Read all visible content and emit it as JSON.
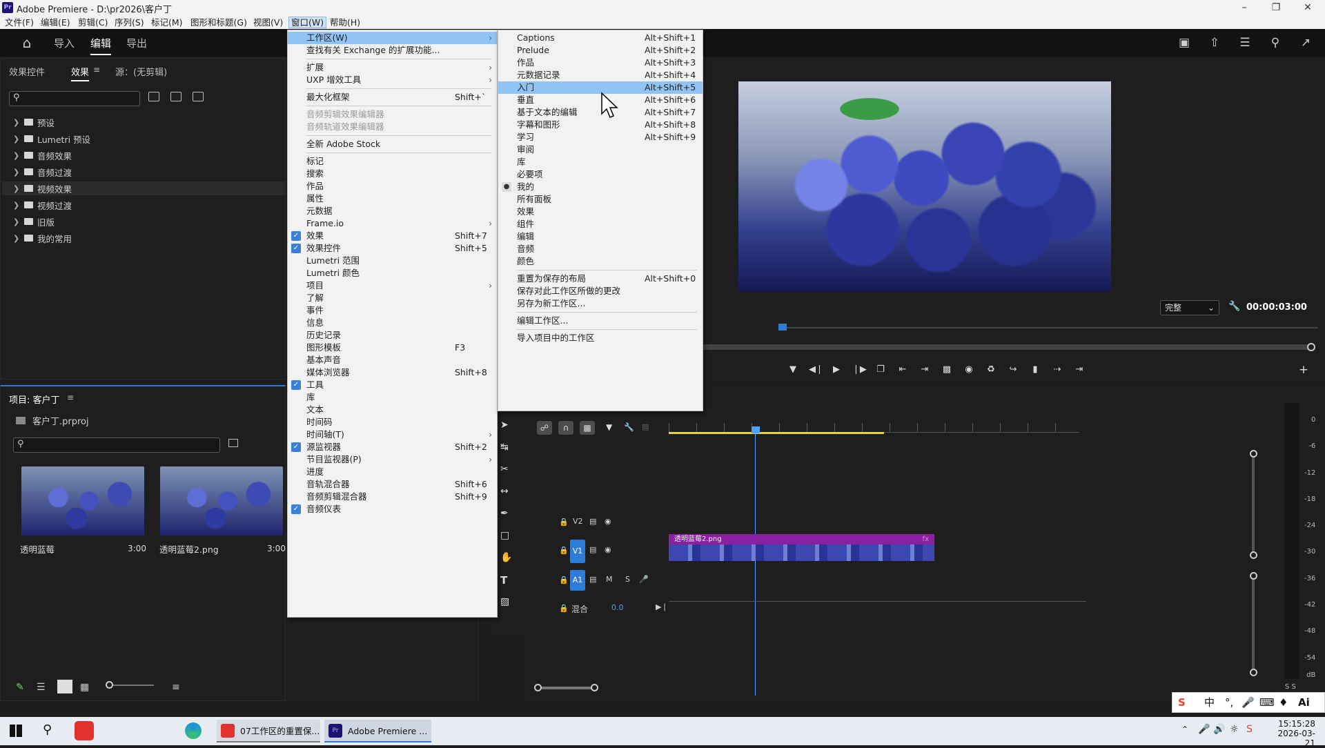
{
  "window": {
    "title": "Adobe Premiere - D:\\pr2026\\客户丁",
    "icon": "Pr"
  },
  "menubar": [
    "文件(F)",
    "编辑(E)",
    "剪辑(C)",
    "序列(S)",
    "标记(M)",
    "图形和标题(G)",
    "视图(V)",
    "窗口(W)",
    "帮助(H)"
  ],
  "header": {
    "tabs": [
      "导入",
      "编辑",
      "导出"
    ]
  },
  "effects_panel": {
    "tabs": [
      "效果控件",
      "效果",
      "源：(无剪辑)"
    ],
    "tree": [
      "预设",
      "Lumetri 预设",
      "音频效果",
      "音频过渡",
      "视频效果",
      "视频过渡",
      "旧版",
      "我的常用"
    ]
  },
  "project_panel": {
    "title": "项目: 客户丁",
    "file": "客户丁.prproj",
    "items": [
      {
        "name": "透明蓝莓",
        "duration": "3:00"
      },
      {
        "name": "透明蓝莓2.png",
        "duration": "3:00"
      }
    ]
  },
  "window_menu": {
    "items": [
      {
        "label": "工作区(W)",
        "submenu": true,
        "highlight": true
      },
      {
        "label": "查找有关 Exchange 的扩展功能..."
      },
      {
        "sep": true
      },
      {
        "label": "扩展",
        "submenu": true
      },
      {
        "label": "UXP 增效工具",
        "submenu": true
      },
      {
        "sep": true
      },
      {
        "label": "最大化框架",
        "shortcut": "Shift+`"
      },
      {
        "sep": true
      },
      {
        "label": "音频剪辑效果编辑器",
        "disabled": true
      },
      {
        "label": "音频轨道效果编辑器",
        "disabled": true
      },
      {
        "sep": true
      },
      {
        "label": "全新 Adobe Stock"
      },
      {
        "sep": true
      },
      {
        "label": "标记"
      },
      {
        "label": "搜索"
      },
      {
        "label": "作品"
      },
      {
        "label": "属性"
      },
      {
        "label": "元数据"
      },
      {
        "label": "Frame.io",
        "submenu": true
      },
      {
        "label": "效果",
        "shortcut": "Shift+7",
        "checked": true
      },
      {
        "label": "效果控件",
        "shortcut": "Shift+5",
        "checked": true
      },
      {
        "label": "Lumetri 范围"
      },
      {
        "label": "Lumetri 颜色"
      },
      {
        "label": "项目",
        "submenu": true
      },
      {
        "label": "了解"
      },
      {
        "label": "事件"
      },
      {
        "label": "信息"
      },
      {
        "label": "历史记录"
      },
      {
        "label": "图形模板",
        "shortcut": "F3"
      },
      {
        "label": "基本声音"
      },
      {
        "label": "媒体浏览器",
        "shortcut": "Shift+8"
      },
      {
        "label": "工具",
        "checked": true
      },
      {
        "label": "库"
      },
      {
        "label": "文本"
      },
      {
        "label": "时间码"
      },
      {
        "label": "时间轴(T)",
        "submenu": true
      },
      {
        "label": "源监视器",
        "shortcut": "Shift+2",
        "checked": true
      },
      {
        "label": "节目监视器(P)",
        "submenu": true
      },
      {
        "label": "进度"
      },
      {
        "label": "音轨混合器",
        "shortcut": "Shift+6"
      },
      {
        "label": "音频剪辑混合器",
        "shortcut": "Shift+9"
      },
      {
        "label": "音频仪表",
        "checked": true
      }
    ]
  },
  "workspace_submenu": {
    "items": [
      {
        "label": "Captions",
        "shortcut": "Alt+Shift+1"
      },
      {
        "label": "Prelude",
        "shortcut": "Alt+Shift+2"
      },
      {
        "label": "作品",
        "shortcut": "Alt+Shift+3"
      },
      {
        "label": "元数据记录",
        "shortcut": "Alt+Shift+4"
      },
      {
        "label": "入门",
        "shortcut": "Alt+Shift+5",
        "highlight": true
      },
      {
        "label": "垂直",
        "shortcut": "Alt+Shift+6"
      },
      {
        "label": "基于文本的编辑",
        "shortcut": "Alt+Shift+7"
      },
      {
        "label": "字幕和图形",
        "shortcut": "Alt+Shift+8"
      },
      {
        "label": "学习",
        "shortcut": "Alt+Shift+9"
      },
      {
        "label": "审阅"
      },
      {
        "label": "库"
      },
      {
        "label": "必要项"
      },
      {
        "label": "我的",
        "bullet": true
      },
      {
        "label": "所有面板"
      },
      {
        "label": "效果"
      },
      {
        "label": "组件"
      },
      {
        "label": "编辑"
      },
      {
        "label": "音频"
      },
      {
        "label": "颜色"
      },
      {
        "sep": true
      },
      {
        "label": "重置为保存的布局",
        "shortcut": "Alt+Shift+0"
      },
      {
        "label": "保存对此工作区所做的更改"
      },
      {
        "label": "另存为新工作区..."
      },
      {
        "sep": true
      },
      {
        "label": "编辑工作区..."
      },
      {
        "sep": true
      },
      {
        "label": "导入项目中的工作区"
      }
    ]
  },
  "program_monitor": {
    "fit": "完整",
    "timecode": "00:00:03:00"
  },
  "timeline": {
    "tracks": [
      "V2",
      "V1",
      "A1"
    ],
    "mix_label": "混合",
    "mix_value": "0.0",
    "clip_name": "透明蓝莓2.png",
    "track_letters": [
      "M",
      "S"
    ],
    "fx": "fx"
  },
  "audio_meter": {
    "ticks": [
      "0",
      "-6",
      "-12",
      "-18",
      "-24",
      "-30",
      "-36",
      "-42",
      "-48",
      "-54",
      "dB"
    ],
    "footer": "S S"
  },
  "taskbar": {
    "items": [
      "07工作区的重置保...",
      "Adobe Premiere ..."
    ],
    "time": "15:15:28",
    "date": "2026-03-21",
    "ime": "中"
  },
  "colors": {
    "accent": "#2f7bd8",
    "clip": "#8a1fa0",
    "playhead": "#4da3ff",
    "menu_highlight": "#91c4f2"
  }
}
